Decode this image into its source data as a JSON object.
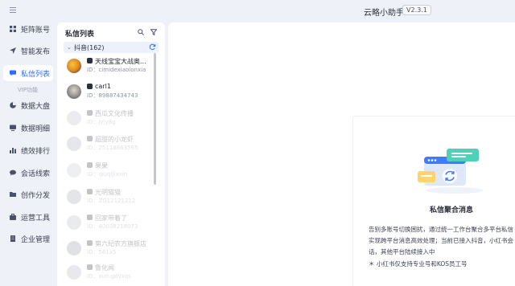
{
  "app": {
    "title": "云略小助手",
    "version": "V2.3.1"
  },
  "sidebar": {
    "items": [
      {
        "label": "矩阵账号",
        "icon": "grid-icon"
      },
      {
        "label": "智能发布",
        "icon": "send-icon"
      },
      {
        "label": "私信列表",
        "icon": "message-icon",
        "active": true
      },
      {
        "label": "数据大盘",
        "icon": "pie-icon"
      },
      {
        "label": "数据明细",
        "icon": "monitor-icon"
      },
      {
        "label": "绩效排行",
        "icon": "bar-chart-icon"
      },
      {
        "label": "会话线索",
        "icon": "chat-icon"
      },
      {
        "label": "创作分发",
        "icon": "folder-icon"
      },
      {
        "label": "运营工具",
        "icon": "toolbox-icon"
      },
      {
        "label": "企业管理",
        "icon": "building-icon"
      }
    ],
    "sub_item": "VIP功能"
  },
  "message_panel": {
    "title": "私信列表",
    "group": {
      "name": "抖音(162)",
      "expanded": true
    },
    "conversations": [
      {
        "name": "天线宝宝大战奥...",
        "uid": "ID：cimidexiaolonxia",
        "faded": false
      },
      {
        "name": "carl1",
        "uid": "ID：89887434743",
        "faded": false
      },
      {
        "name": "西瓜文化传播",
        "uid": "ID：jyjy8g",
        "faded": true
      },
      {
        "name": "超甜的小龙虾",
        "uid": "ID：25118663565",
        "faded": true
      },
      {
        "name": "果果",
        "uid": "ID：qiuqijiaxin",
        "faded": true
      },
      {
        "name": "光明猫猫",
        "uid": "ID：ZG12121212",
        "faded": true
      },
      {
        "name": "回家带着了",
        "uid": "ID：40038218073",
        "faded": true
      },
      {
        "name": "第六纪农方旗舰店",
        "uid": "ID：561x5",
        "faded": true
      },
      {
        "name": "鲁化闻",
        "uid": "ID：xun.gdvxqs",
        "faded": true
      }
    ]
  },
  "main": {
    "card_title": "私信聚合消息",
    "description_lines": [
      "告别多账号切换困扰，通过统一工作台聚合多平台私信",
      "实现跨平台消息高效处理；当前已接入抖音，小红书会",
      "话，其他平台陆续接入中"
    ],
    "note": "＊ 小红书仅支持专业号和KOS员工号"
  },
  "colors": {
    "accent": "#2f6bff",
    "background": "#eef1f7",
    "panel": "#ffffff"
  }
}
